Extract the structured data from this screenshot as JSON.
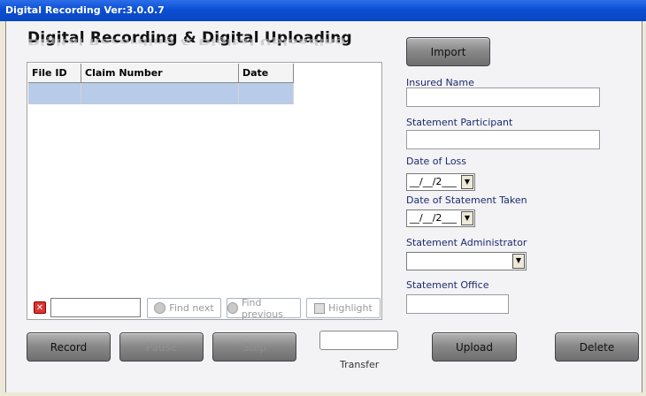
{
  "window": {
    "title": "Digital Recording   Ver:3.0.0.7"
  },
  "header": {
    "title": "Digital Recording & Digital Uploading"
  },
  "grid": {
    "columns": [
      "File ID",
      "Claim Number",
      "Date"
    ],
    "rows": [
      [
        "",
        "",
        ""
      ]
    ]
  },
  "search": {
    "value": "",
    "find_next": "Find next",
    "find_previous": "Find previous",
    "highlight": "Highlight"
  },
  "buttons": {
    "import": "Import",
    "record": "Record",
    "pause": "Pause",
    "stop": "Stop",
    "upload": "Upload",
    "delete": "Delete"
  },
  "transfer": {
    "value": "",
    "label": "Transfer"
  },
  "form": {
    "insured_name": {
      "label": "Insured Name",
      "value": ""
    },
    "statement_participant": {
      "label": "Statement Participant",
      "value": ""
    },
    "date_of_loss": {
      "label": "Date of Loss",
      "value": "__/__/2___"
    },
    "date_of_statement": {
      "label": "Date of Statement Taken",
      "value": "__/__/2___"
    },
    "statement_administrator": {
      "label": "Statement Administrator",
      "value": ""
    },
    "statement_office": {
      "label": "Statement Office",
      "value": ""
    }
  }
}
